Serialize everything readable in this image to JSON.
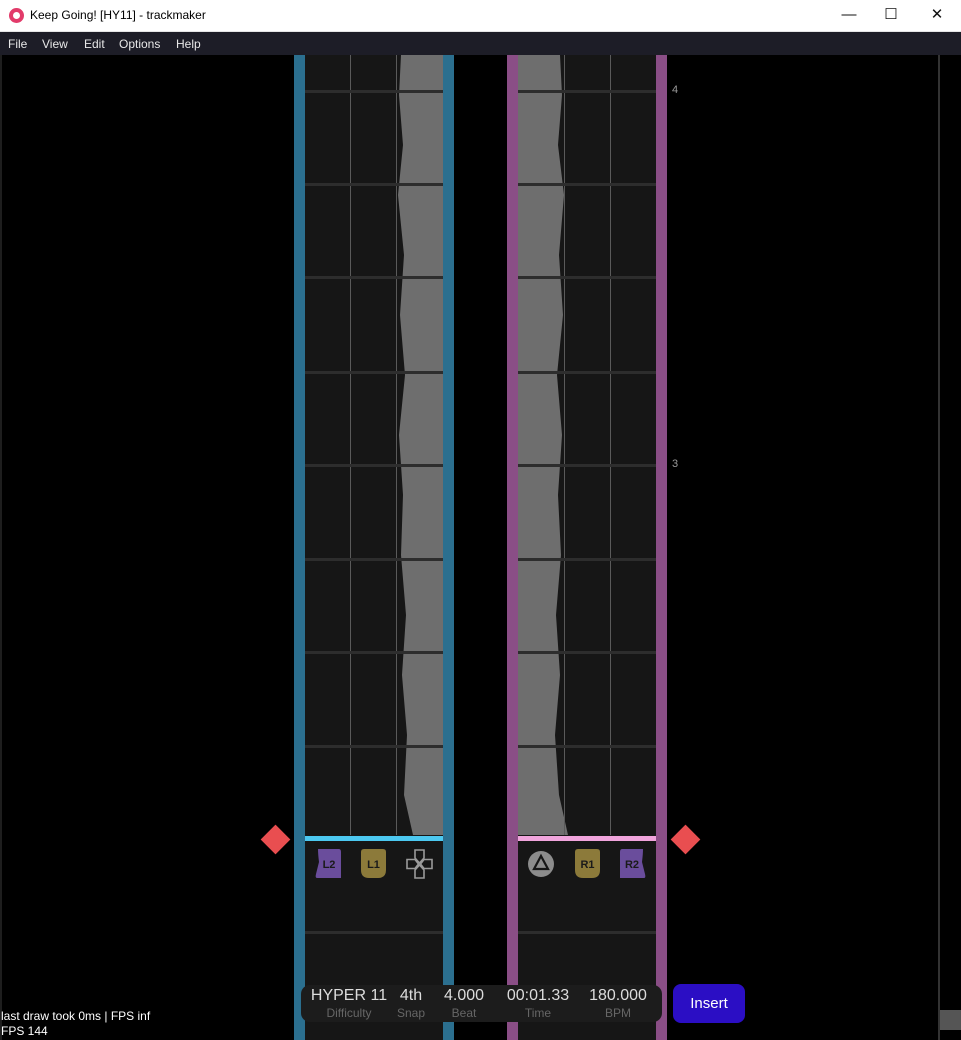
{
  "window": {
    "title": "Keep Going! [HY11] - trackmaker",
    "minimize_glyph": "—",
    "maximize_glyph": "☐",
    "close_glyph": "✕"
  },
  "menu": [
    "File",
    "View",
    "Edit",
    "Options",
    "Help"
  ],
  "measures": [
    "4",
    "3"
  ],
  "left_lane": {
    "accent": "#2b6f8f",
    "judge_color": "#4cc8f0",
    "buttons": [
      {
        "label": "L2",
        "icon": "l2-trigger-icon",
        "color": "#6a4d9c"
      },
      {
        "label": "L1",
        "icon": "l1-bumper-icon",
        "color": "#8c7a3a"
      },
      {
        "label": "",
        "icon": "dpad-icon",
        "color": "#9a9a9a"
      }
    ]
  },
  "right_lane": {
    "accent": "#8a4e86",
    "judge_color": "#f0a4dc",
    "buttons": [
      {
        "label": "",
        "icon": "triangle-button-icon",
        "color": "#8c8c8c"
      },
      {
        "label": "R1",
        "icon": "r1-bumper-icon",
        "color": "#8c7a3a"
      },
      {
        "label": "R2",
        "icon": "r2-trigger-icon",
        "color": "#6a4d9c"
      }
    ]
  },
  "hud": {
    "difficulty": {
      "value": "HYPER 11",
      "label": "Difficulty"
    },
    "snap": {
      "value": "4th",
      "label": "Snap"
    },
    "beat": {
      "value": "4.000",
      "label": "Beat"
    },
    "time": {
      "value": "00:01.33",
      "label": "Time"
    },
    "bpm": {
      "value": "180.000",
      "label": "BPM"
    },
    "insert_label": "Insert"
  },
  "status": {
    "draw_info": "last draw took 0ms | FPS inf",
    "fps": "FPS 144"
  },
  "colors": {
    "playhead_diamond": "#e94e50",
    "insert_button": "#2b0ec4",
    "waveform": "#6e6e6e"
  }
}
